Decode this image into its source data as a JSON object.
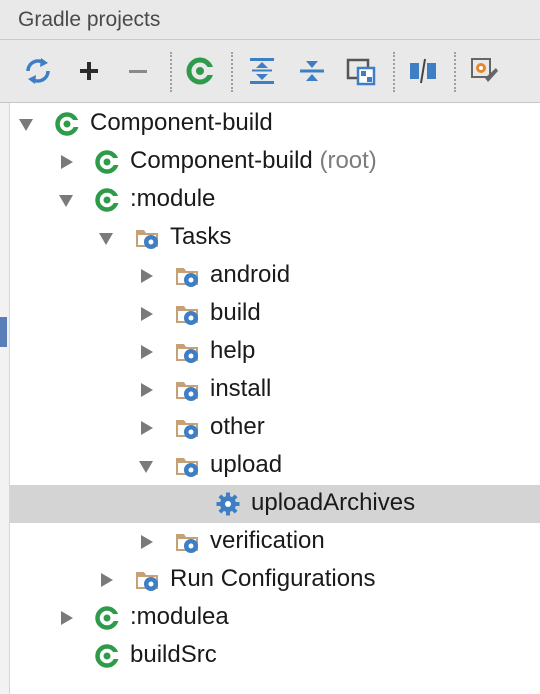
{
  "panel": {
    "title": "Gradle projects"
  },
  "toolbar": {
    "buttons": [
      {
        "name": "refresh-all-button",
        "icon": "refresh-icon"
      },
      {
        "name": "add-project-button",
        "icon": "plus-icon"
      },
      {
        "name": "remove-project-button",
        "icon": "minus-icon"
      },
      {
        "name": "execute-task-button",
        "icon": "gradle-icon"
      },
      {
        "name": "expand-all-button",
        "icon": "expand-all-icon"
      },
      {
        "name": "collapse-all-button",
        "icon": "collapse-all-icon"
      },
      {
        "name": "group-tasks-button",
        "icon": "group-icon"
      },
      {
        "name": "toggle-offline-button",
        "icon": "offline-icon"
      },
      {
        "name": "gradle-settings-button",
        "icon": "settings-wrench-icon"
      }
    ]
  },
  "tree": {
    "nodes": [
      {
        "label": "Component-build",
        "suffix": "",
        "icon": "gradle-project-icon",
        "expanded": true
      },
      {
        "label": "Component-build",
        "suffix": "(root)",
        "icon": "gradle-project-icon",
        "expanded": false
      },
      {
        "label": ":module",
        "suffix": "",
        "icon": "gradle-project-icon",
        "expanded": true
      },
      {
        "label": "Tasks",
        "suffix": "",
        "icon": "task-folder-icon",
        "expanded": true
      },
      {
        "label": "android",
        "suffix": "",
        "icon": "task-folder-icon",
        "expanded": false
      },
      {
        "label": "build",
        "suffix": "",
        "icon": "task-folder-icon",
        "expanded": false
      },
      {
        "label": "help",
        "suffix": "",
        "icon": "task-folder-icon",
        "expanded": false
      },
      {
        "label": "install",
        "suffix": "",
        "icon": "task-folder-icon",
        "expanded": false
      },
      {
        "label": "other",
        "suffix": "",
        "icon": "task-folder-icon",
        "expanded": false
      },
      {
        "label": "upload",
        "suffix": "",
        "icon": "task-folder-icon",
        "expanded": true
      },
      {
        "label": "uploadArchives",
        "suffix": "",
        "icon": "gear-task-icon",
        "selected": true
      },
      {
        "label": "verification",
        "suffix": "",
        "icon": "task-folder-icon",
        "expanded": false
      },
      {
        "label": "Run Configurations",
        "suffix": "",
        "icon": "task-folder-icon",
        "expanded": false
      },
      {
        "label": ":modulea",
        "suffix": "",
        "icon": "gradle-project-icon",
        "expanded": false
      },
      {
        "label": "buildSrc",
        "suffix": "",
        "icon": "gradle-project-icon"
      }
    ]
  },
  "colors": {
    "gradle_green": "#2e9b4a",
    "icon_blue": "#3d7ec4",
    "folder_tan": "#c6a178",
    "selection": "#d4d4d4"
  }
}
